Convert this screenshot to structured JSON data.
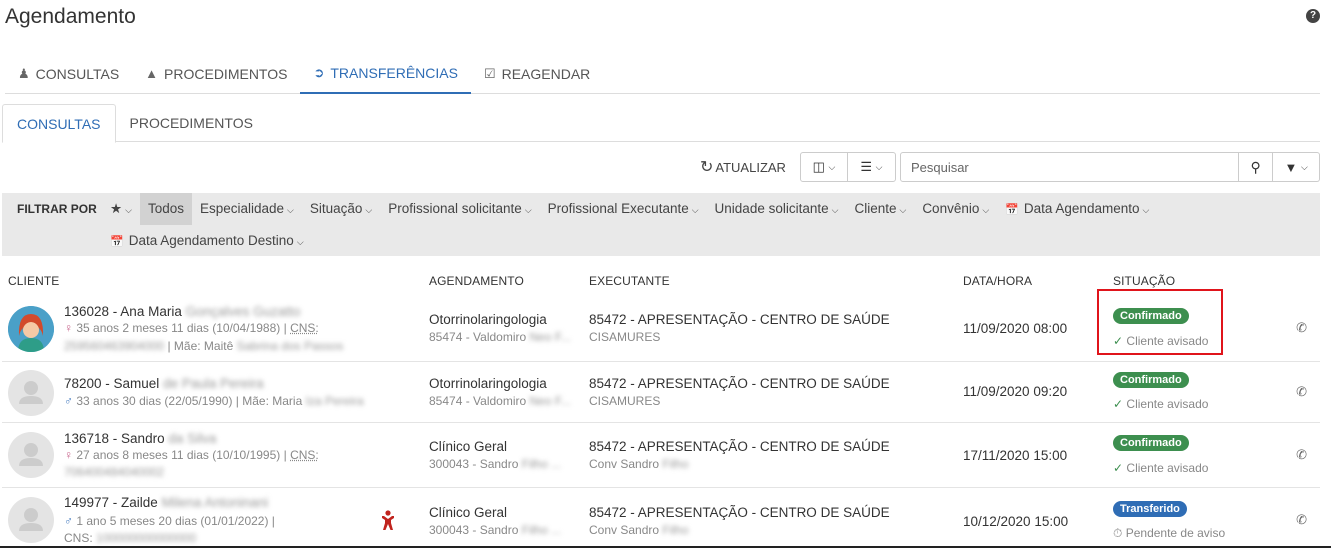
{
  "page": {
    "title": "Agendamento",
    "help_icon": "question-icon"
  },
  "top_tabs": [
    {
      "label": "CONSULTAS",
      "icon": "doctor-icon",
      "active": false
    },
    {
      "label": "PROCEDIMENTOS",
      "icon": "flask-icon",
      "active": false
    },
    {
      "label": "TRANSFERÊNCIAS",
      "icon": "sign-out-icon",
      "active": true
    },
    {
      "label": "REAGENDAR",
      "icon": "calendar-check-icon",
      "active": false
    }
  ],
  "sub_tabs": [
    {
      "label": "CONSULTAS",
      "active": true
    },
    {
      "label": "PROCEDIMENTOS",
      "active": false
    }
  ],
  "toolbar": {
    "refresh_label": "ATUALIZAR",
    "search_placeholder": "Pesquisar"
  },
  "filters": {
    "label": "FILTRAR POR",
    "row1": [
      "Todos",
      "Especialidade",
      "Situação",
      "Profissional solicitante",
      "Profissional Executante",
      "Unidade solicitante",
      "Cliente",
      "Convênio",
      "Data Agendamento"
    ],
    "row2": [
      "Data Agendamento Destino"
    ]
  },
  "columns": {
    "cliente": "CLIENTE",
    "agendamento": "AGENDAMENTO",
    "executante": "EXECUTANTE",
    "datahora": "DATA/HORA",
    "situacao": "SITUAÇÃO"
  },
  "rows": [
    {
      "name": "136028 - Ana Maria",
      "name_blur": "Gonçalves Guzatto",
      "line2": "35 anos 2 meses 11 dias (10/04/1988) |",
      "cns_label": "CNS:",
      "line3_blur": "259560463904000",
      "line3": "| Mãe: Maitê",
      "line3_blur2": "Sabrina dos Passos",
      "specialty": "Otorrinolaringologia",
      "professional": "85474 - Valdomiro",
      "professional_blur": "Neo F...",
      "executor": "85472 - APRESENTAÇÃO - CENTRO DE SAÚDE",
      "executor_sub": "CISAMURES",
      "datetime": "11/09/2020 08:00",
      "status": "Confirmado",
      "status_sub": "Cliente avisado"
    },
    {
      "name": "78200 - Samuel",
      "name_blur": "de Paula Pereira",
      "line2": "33 anos 30 dias (22/05/1990) | Mãe: Maria",
      "line2_blur": "Iza Pereira",
      "specialty": "Otorrinolaringologia",
      "professional": "85474 - Valdomiro",
      "professional_blur": "Neo F...",
      "executor": "85472 - APRESENTAÇÃO - CENTRO DE SAÚDE",
      "executor_sub": "CISAMURES",
      "datetime": "11/09/2020 09:20",
      "status": "Confirmado",
      "status_sub": "Cliente avisado"
    },
    {
      "name": "136718 - Sandro",
      "name_blur": "da Silva",
      "line2": "27 anos 8 meses 11 dias (10/10/1995) |",
      "cns_label": "CNS:",
      "line3_blur": "706400484040002",
      "specialty": "Clínico Geral",
      "professional": "300043 - Sandro",
      "professional_blur": "Filho ...",
      "executor": "85472 - APRESENTAÇÃO - CENTRO DE SAÚDE",
      "executor_sub": "Conv Sandro",
      "executor_sub_blur": "Filho",
      "datetime": "17/11/2020 15:00",
      "status": "Confirmado",
      "status_sub": "Cliente avisado"
    },
    {
      "name": "149977 - Zailde",
      "name_blur": "Milena Antoninani",
      "line2": "1 ano 5 meses 20 dias (01/01/2022) |",
      "cns_label": "CNS:",
      "line3_blur": "100000000000000",
      "specialty": "Clínico Geral",
      "professional": "300043 - Sandro",
      "professional_blur": "Filho ...",
      "executor": "85472 - APRESENTAÇÃO - CENTRO DE SAÚDE",
      "executor_sub": "Conv Sandro",
      "executor_sub_blur": "Filho",
      "datetime": "10/12/2020 15:00",
      "status": "Transferido",
      "status_sub": "Pendente de aviso"
    }
  ],
  "colors": {
    "accent": "#2f6db5",
    "confirmed": "#3d8f4f",
    "transferred": "#2f6db5",
    "highlight": "#e0141b",
    "female": "#c9678e",
    "male": "#4a7fc1",
    "child_icon": "#c0241e"
  }
}
